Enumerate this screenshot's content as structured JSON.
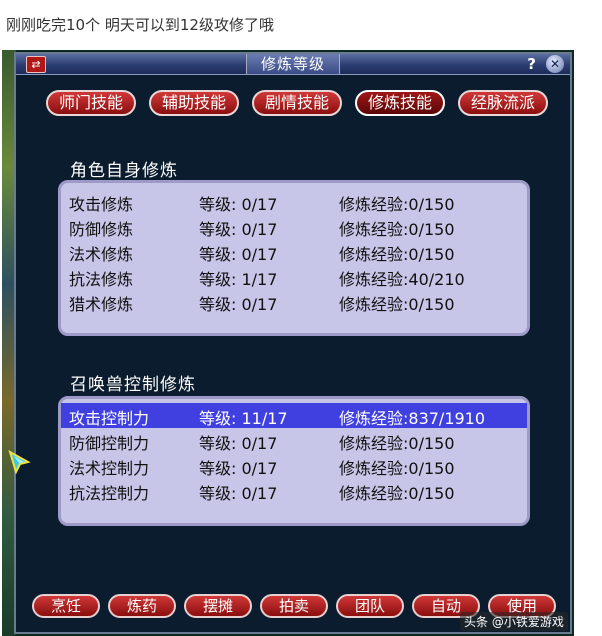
{
  "caption": "刚刚吃完10个 明天可以到12级攻修了哦",
  "window": {
    "title": "修炼等级",
    "help_label": "?",
    "close_label": "✕",
    "swap_label": "⇄"
  },
  "tabs": [
    {
      "label": "师门技能"
    },
    {
      "label": "辅助技能"
    },
    {
      "label": "剧情技能"
    },
    {
      "label": "修炼技能"
    },
    {
      "label": "经脉流派"
    }
  ],
  "char_section": {
    "title": "角色自身修炼",
    "rows": [
      {
        "name": "攻击修炼",
        "level": "等级: 0/17",
        "exp": "修炼经验:0/150"
      },
      {
        "name": "防御修炼",
        "level": "等级: 0/17",
        "exp": "修炼经验:0/150"
      },
      {
        "name": "法术修炼",
        "level": "等级: 0/17",
        "exp": "修炼经验:0/150"
      },
      {
        "name": "抗法修炼",
        "level": "等级: 1/17",
        "exp": "修炼经验:40/210"
      },
      {
        "name": "猎术修炼",
        "level": "等级: 0/17",
        "exp": "修炼经验:0/150"
      }
    ]
  },
  "pet_section": {
    "title": "召唤兽控制修炼",
    "rows": [
      {
        "name": "攻击控制力",
        "level": "等级: 11/17",
        "exp": "修炼经验:837/1910"
      },
      {
        "name": "防御控制力",
        "level": "等级: 0/17",
        "exp": "修炼经验:0/150"
      },
      {
        "name": "法术控制力",
        "level": "等级: 0/17",
        "exp": "修炼经验:0/150"
      },
      {
        "name": "抗法控制力",
        "level": "等级: 0/17",
        "exp": "修炼经验:0/150"
      }
    ]
  },
  "bottom_buttons": [
    {
      "label": "烹饪"
    },
    {
      "label": "炼药"
    },
    {
      "label": "摆摊"
    },
    {
      "label": "拍卖"
    },
    {
      "label": "团队"
    },
    {
      "label": "自动"
    },
    {
      "label": "使用"
    }
  ],
  "watermark": "头条 @小铁爱游戏",
  "colors": {
    "selected_row": "#4040e0",
    "panel_bg": "#c8c6e8",
    "button_red": "#b01818"
  }
}
